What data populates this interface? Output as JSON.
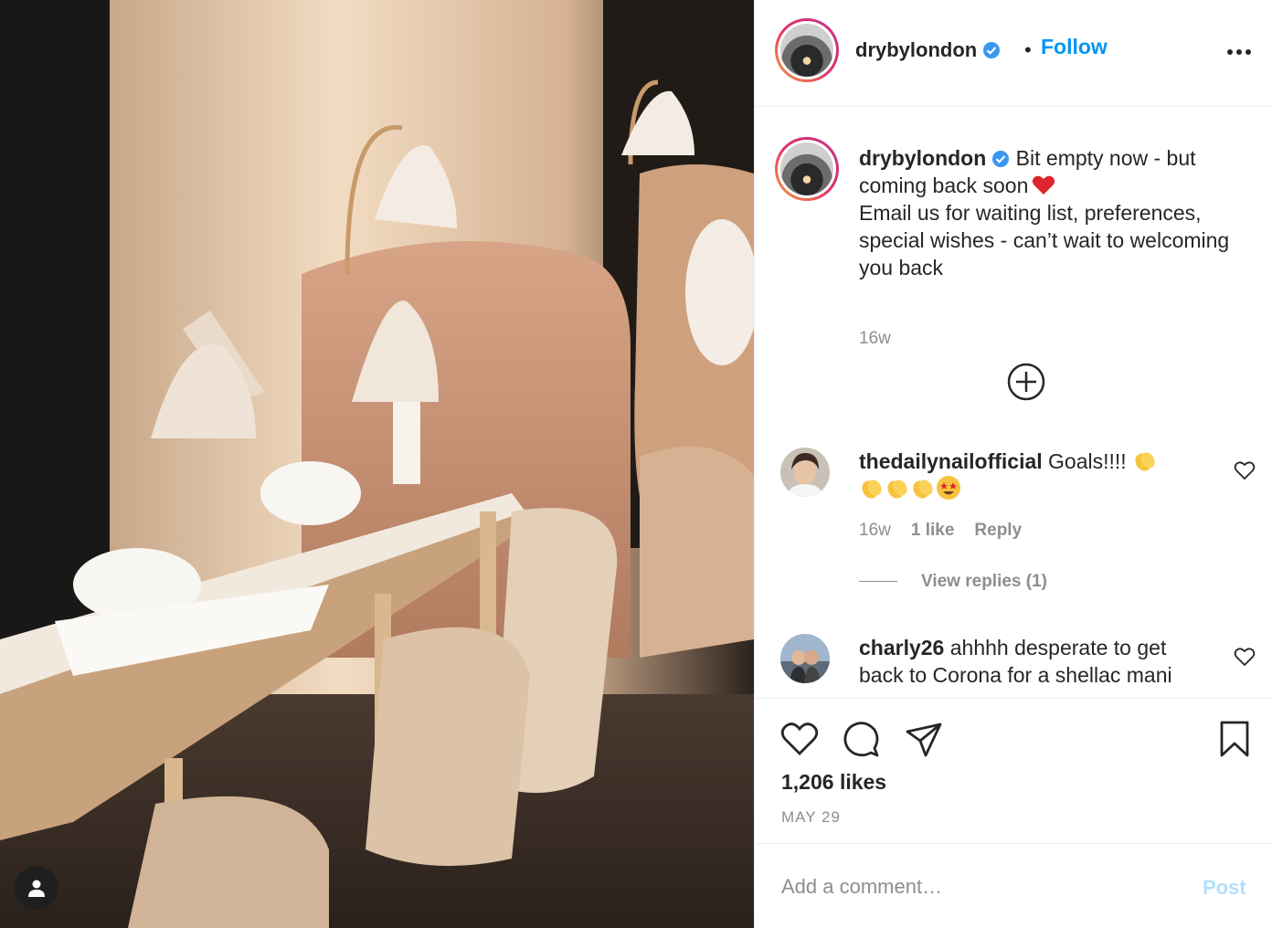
{
  "post": {
    "author": "drybylondon",
    "follow_label": "Follow",
    "separator": "•",
    "caption": {
      "username": "drybylondon",
      "line1": "Bit empty now - but coming back soon",
      "line2": "Email us for waiting list, preferences, special wishes - can’t wait to welcoming you back",
      "time": "16w"
    },
    "comments": [
      {
        "username": "thedailynailofficial",
        "text": "Goals!!!!",
        "emojis": [
          "clapping-hands",
          "clapping-hands",
          "clapping-hands",
          "clapping-hands",
          "star-struck-face"
        ],
        "time": "16w",
        "likes": "1 like",
        "reply": "Reply",
        "view_replies": "View replies (1)"
      },
      {
        "username": "charly26",
        "text": "ahhhh desperate to get back to Corona for a shellac mani"
      }
    ],
    "likes": "1,206 likes",
    "date": "MAY 29",
    "comment_placeholder": "Add a comment…",
    "post_label": "Post"
  },
  "icons": {
    "header_more": "more-horizontal-icon",
    "verified": "verified-badge-icon",
    "load_more": "plus-circle-icon",
    "like": "heart-icon",
    "comment": "comment-icon",
    "share": "paper-plane-icon",
    "save": "bookmark-icon",
    "tag": "user-tag-icon"
  },
  "colors": {
    "accent": "#0095f6",
    "verified": "#3897f0",
    "muted": "#8e8e8e",
    "post_disabled": "#b2dffc"
  }
}
